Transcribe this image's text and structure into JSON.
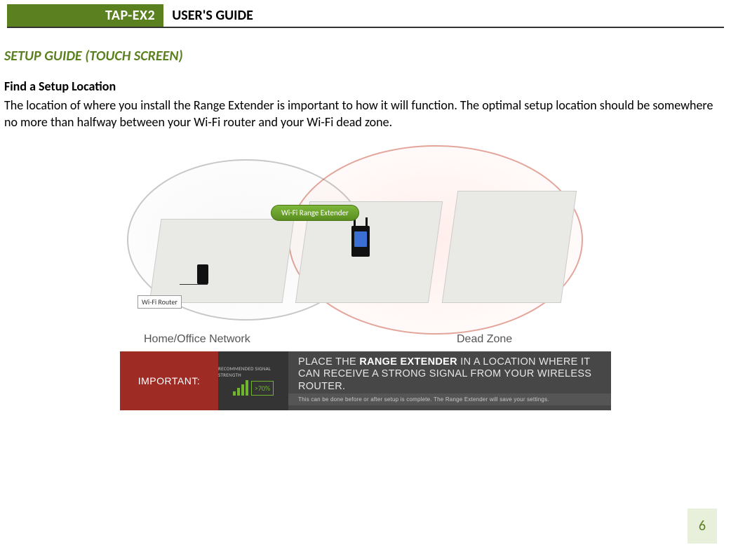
{
  "header": {
    "model": "TAP-EX2",
    "title": "USER'S GUIDE"
  },
  "section_title": "SETUP GUIDE (TOUCH SCREEN)",
  "subheading": "Find a Setup Location",
  "paragraph": "The location of where you install the Range Extender is important to how it will function. The optimal setup location should be somewhere no more than halfway between your Wi-Fi router and your Wi-Fi dead zone.",
  "figure": {
    "router_label": "Wi-Fi Router",
    "extender_label": "Wi-Fi Range Extender",
    "left_caption": "Home/Office Network",
    "right_caption": "Dead Zone"
  },
  "banner": {
    "important": "IMPORTANT:",
    "signal_top": "RECOMMENDED SIGNAL STRENGTH",
    "signal_pct": ">70%",
    "msg_pre": "PLACE THE ",
    "msg_bold": "RANGE EXTENDER",
    "msg_post": " IN A LOCATION WHERE IT CAN RECEIVE A STRONG SIGNAL FROM YOUR WIRELESS ROUTER.",
    "subnote": "This can be done before or after setup is complete. The Range Extender will save your settings."
  },
  "page_number": "6"
}
